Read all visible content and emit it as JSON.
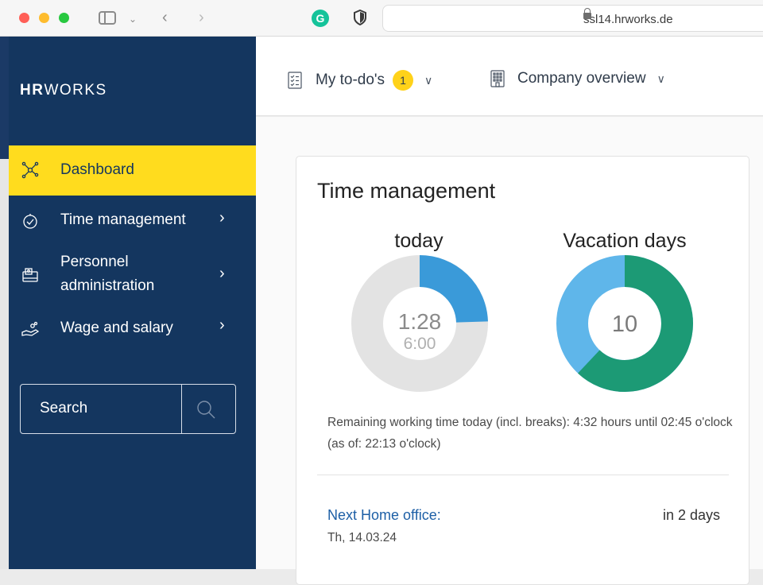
{
  "browser": {
    "url": "ssl14.hrworks.de",
    "icons": [
      "sidebar-toggle-icon",
      "chevron-down-icon",
      "back-icon",
      "forward-icon",
      "grammarly-icon",
      "shield-icon",
      "lock-icon"
    ],
    "grammarly_letter": "G"
  },
  "sidebar": {
    "logo_bold": "HR",
    "logo_thin": "WORKS",
    "items": [
      {
        "label": "Dashboard",
        "icon": "network-icon",
        "active": true
      },
      {
        "label": "Time management",
        "icon": "stopwatch-icon",
        "has_submenu": true
      },
      {
        "label_line1": "Personnel",
        "label_line2": "administration",
        "icon": "id-card-icon",
        "has_submenu": true
      },
      {
        "label": "Wage and salary",
        "icon": "salary-icon",
        "has_submenu": true
      }
    ],
    "search_label": "Search"
  },
  "header": {
    "todo_label": "My to-do's",
    "todo_count": "1",
    "company_label": "Company overview"
  },
  "time_management": {
    "title": "Time management",
    "today": {
      "label": "today",
      "worked": "1:28",
      "target": "6:00",
      "fraction": 0.245
    },
    "vacation": {
      "label": "Vacation days",
      "remaining": "10",
      "fraction_green": 0.62
    },
    "remaining_text": "Remaining working time today (incl. breaks): 4:32 hours until 02:45 o'clock (as of: 22:13 o'clock)",
    "next_home_office_label": "Next Home office:",
    "next_home_office_date": "Th, 14.03.24",
    "next_home_office_in": "in 2 days"
  },
  "colors": {
    "sidebar_bg": "#14365f",
    "active_item": "#ffdc1e",
    "today_fill": "#3a9ad9",
    "today_track": "#e3e3e3",
    "vacation_green": "#1c9a75",
    "vacation_blue": "#5fb6ea",
    "link": "#1d5fa6"
  }
}
